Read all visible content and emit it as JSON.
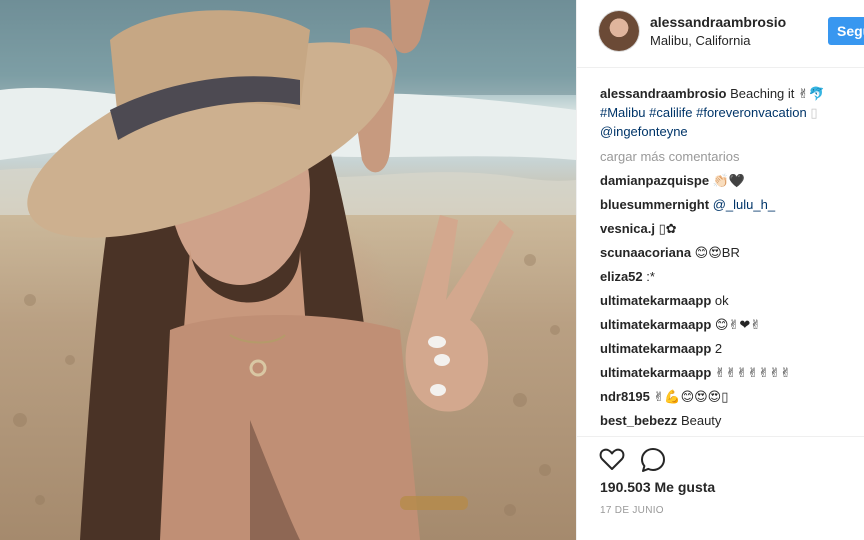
{
  "post": {
    "username": "alessandraambrosio",
    "location": "Malibu, California",
    "follow_label": "Segu",
    "caption_text": "Beaching it ✌🐬",
    "caption_tags": "#Malibu #calilife #foreveronvacation",
    "caption_tail": "▯",
    "caption_mention": "@ingefonteyne",
    "load_more": "cargar más comentarios",
    "likes": "190.503 Me gusta",
    "date": "17 DE JUNIO"
  },
  "comments": [
    {
      "user": "damianpazquispe",
      "text": "👏🏻🖤",
      "mention": ""
    },
    {
      "user": "bluesummernight",
      "text": "",
      "mention": "@_lulu_h_"
    },
    {
      "user": "vesnica.j",
      "text": "▯✿",
      "mention": ""
    },
    {
      "user": "scunaacoriana",
      "text": "😊😍BR",
      "mention": ""
    },
    {
      "user": "eliza52",
      "text": ":*",
      "mention": ""
    },
    {
      "user": "ultimatekarmaapp",
      "text": "ok",
      "mention": ""
    },
    {
      "user": "ultimatekarmaapp",
      "text": "😊✌❤✌",
      "mention": ""
    },
    {
      "user": "ultimatekarmaapp",
      "text": "2",
      "mention": ""
    },
    {
      "user": "ultimatekarmaapp",
      "text": "✌✌✌✌✌✌✌",
      "mention": ""
    },
    {
      "user": "ndr8195",
      "text": "✌💪😊😍😍▯",
      "mention": ""
    },
    {
      "user": "best_bebezz",
      "text": "Beauty",
      "mention": ""
    }
  ],
  "icons": {
    "like": "heart-icon",
    "comment": "speech-bubble-icon"
  },
  "colors": {
    "accent": "#3897f0",
    "hashtag": "#003569",
    "muted": "#999999",
    "text": "#262626"
  }
}
